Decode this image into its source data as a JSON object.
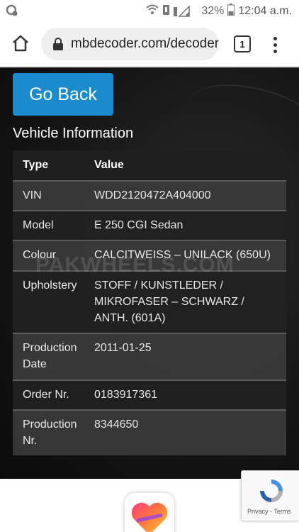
{
  "status_bar": {
    "battery": "32%",
    "time": "12:04 a.m."
  },
  "browser": {
    "url": "mbdecoder.com/decoder",
    "tab_count": "1"
  },
  "page": {
    "go_back_label": "Go Back",
    "section_title": "Vehicle Information",
    "watermark": "PAKWHEELS.COM",
    "table": {
      "headers": [
        "Type",
        "Value"
      ],
      "rows": [
        {
          "type": "VIN",
          "value": "WDD2120472A404000"
        },
        {
          "type": "Model",
          "value": "E 250 CGI Sedan"
        },
        {
          "type": "Colour",
          "value": "CALCITWEISS – UNILACK (650U)"
        },
        {
          "type": "Upholstery",
          "value": "STOFF / KUNSTLEDER / MIKROFASER – SCHWARZ / ANTH. (601A)"
        },
        {
          "type": "Production Date",
          "value": "2011-01-25"
        },
        {
          "type": "Order Nr.",
          "value": "0183917361"
        },
        {
          "type": "Production Nr.",
          "value": "8344650"
        }
      ]
    }
  },
  "recaptcha": {
    "links": "Privacy - Terms"
  },
  "colors": {
    "button": "#1a8ccd",
    "page_bg": "#141414"
  }
}
